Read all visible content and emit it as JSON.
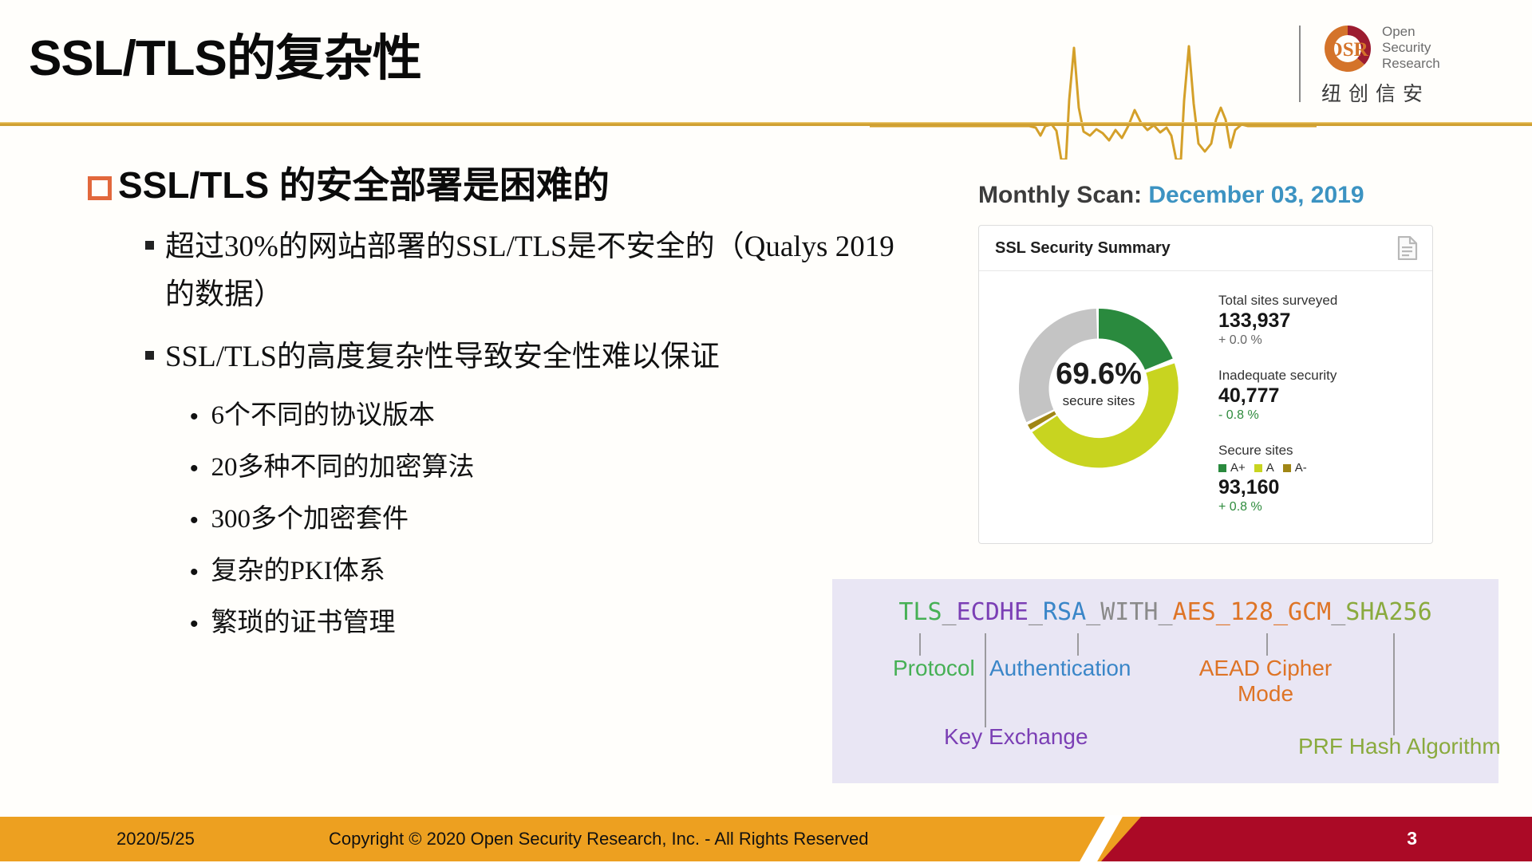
{
  "slide": {
    "title": "SSL/TLS的复杂性",
    "page_number": "3"
  },
  "logo": {
    "mark_text": "OSR",
    "line1": "Open",
    "line2": "Security",
    "line3": "Research",
    "chinese": "纽创信安",
    "mark_color_top": "#9c1c30",
    "mark_color_bottom": "#d4732a"
  },
  "content": {
    "lead": "SSL/TLS 的安全部署是困难的",
    "level2": [
      "超过30%的网站部署的SSL/TLS是不安全的（Qualys 2019的数据）",
      "SSL/TLS的高度复杂性导致安全性难以保证"
    ],
    "level3": [
      "6个不同的协议版本",
      "20多种不同的加密算法",
      "300多个加密套件",
      "复杂的PKI体系",
      "繁琐的证书管理"
    ]
  },
  "scan": {
    "heading_label": "Monthly Scan:",
    "heading_value": "December 03, 2019",
    "card_title": "SSL Security Summary",
    "card_icon": "document-icon",
    "center_percent": "69.6%",
    "center_sub": "secure sites",
    "stats": [
      {
        "label": "Total sites surveyed",
        "value": "133,937",
        "delta": "+ 0.0 %",
        "delta_tone": "neutral"
      },
      {
        "label": "Inadequate security",
        "value": "40,777",
        "delta": "- 0.8 %",
        "delta_tone": "green"
      },
      {
        "label": "Secure sites",
        "value": "93,160",
        "delta": "+ 0.8 %",
        "delta_tone": "green"
      }
    ],
    "legend": [
      {
        "label": "A+",
        "color": "#2a8a3e"
      },
      {
        "label": "A",
        "color": "#c8d420"
      },
      {
        "label": "A-",
        "color": "#a08615"
      }
    ]
  },
  "chart_data": {
    "type": "pie",
    "title": "SSL Security Summary",
    "subtitle": "Monthly Scan: December 03, 2019",
    "center_label": "69.6%",
    "center_sublabel": "secure sites",
    "categories": [
      "A+",
      "A",
      "A-",
      "Inadequate security"
    ],
    "values": [
      19.0,
      46.6,
      1.3,
      33.1
    ],
    "value_unit": "percent of total sites surveyed",
    "colors": [
      "#2a8a3e",
      "#c8d420",
      "#a08615",
      "#c4c4c4"
    ],
    "legend": "right",
    "grid": false,
    "totals": {
      "total_sites_surveyed": 133937,
      "total_sites_surveyed_delta": "+ 0.0 %",
      "inadequate_security": 40777,
      "inadequate_security_delta": "- 0.8 %",
      "secure_sites": 93160,
      "secure_sites_delta": "+ 0.8 %",
      "secure_percent": 69.6
    }
  },
  "cipher": {
    "tokens": [
      {
        "text": "TLS",
        "class": "protocol"
      },
      {
        "text": "ECDHE",
        "class": "kex"
      },
      {
        "text": "RSA",
        "class": "auth"
      },
      {
        "text": "WITH",
        "class": "with"
      },
      {
        "text": "AES",
        "class": "cipher"
      },
      {
        "text": "128",
        "class": "cipher"
      },
      {
        "text": "GCM",
        "class": "cipher"
      },
      {
        "text": "SHA256",
        "class": "hash"
      }
    ],
    "full_string": "TLS_ECDHE_RSA_WITH_AES_128_GCM_SHA256",
    "labels": {
      "protocol": "Protocol",
      "authentication": "Authentication",
      "aead_line1": "AEAD Cipher",
      "aead_line2": "Mode",
      "key_exchange": "Key Exchange",
      "prf": "PRF Hash Algorithm"
    },
    "colors": {
      "protocol": "#46b055",
      "key_exchange": "#7b3fb5",
      "authentication": "#3a86c8",
      "with": "#8a8a8a",
      "cipher": "#de7426",
      "hash": "#8aaa3e"
    }
  },
  "footer": {
    "date": "2020/5/25",
    "copyright": "Copyright © 2020 Open Security Research, Inc. - All Rights Reserved",
    "page": "3",
    "bar_color": "#eda020",
    "accent_color": "#ab0a26"
  }
}
